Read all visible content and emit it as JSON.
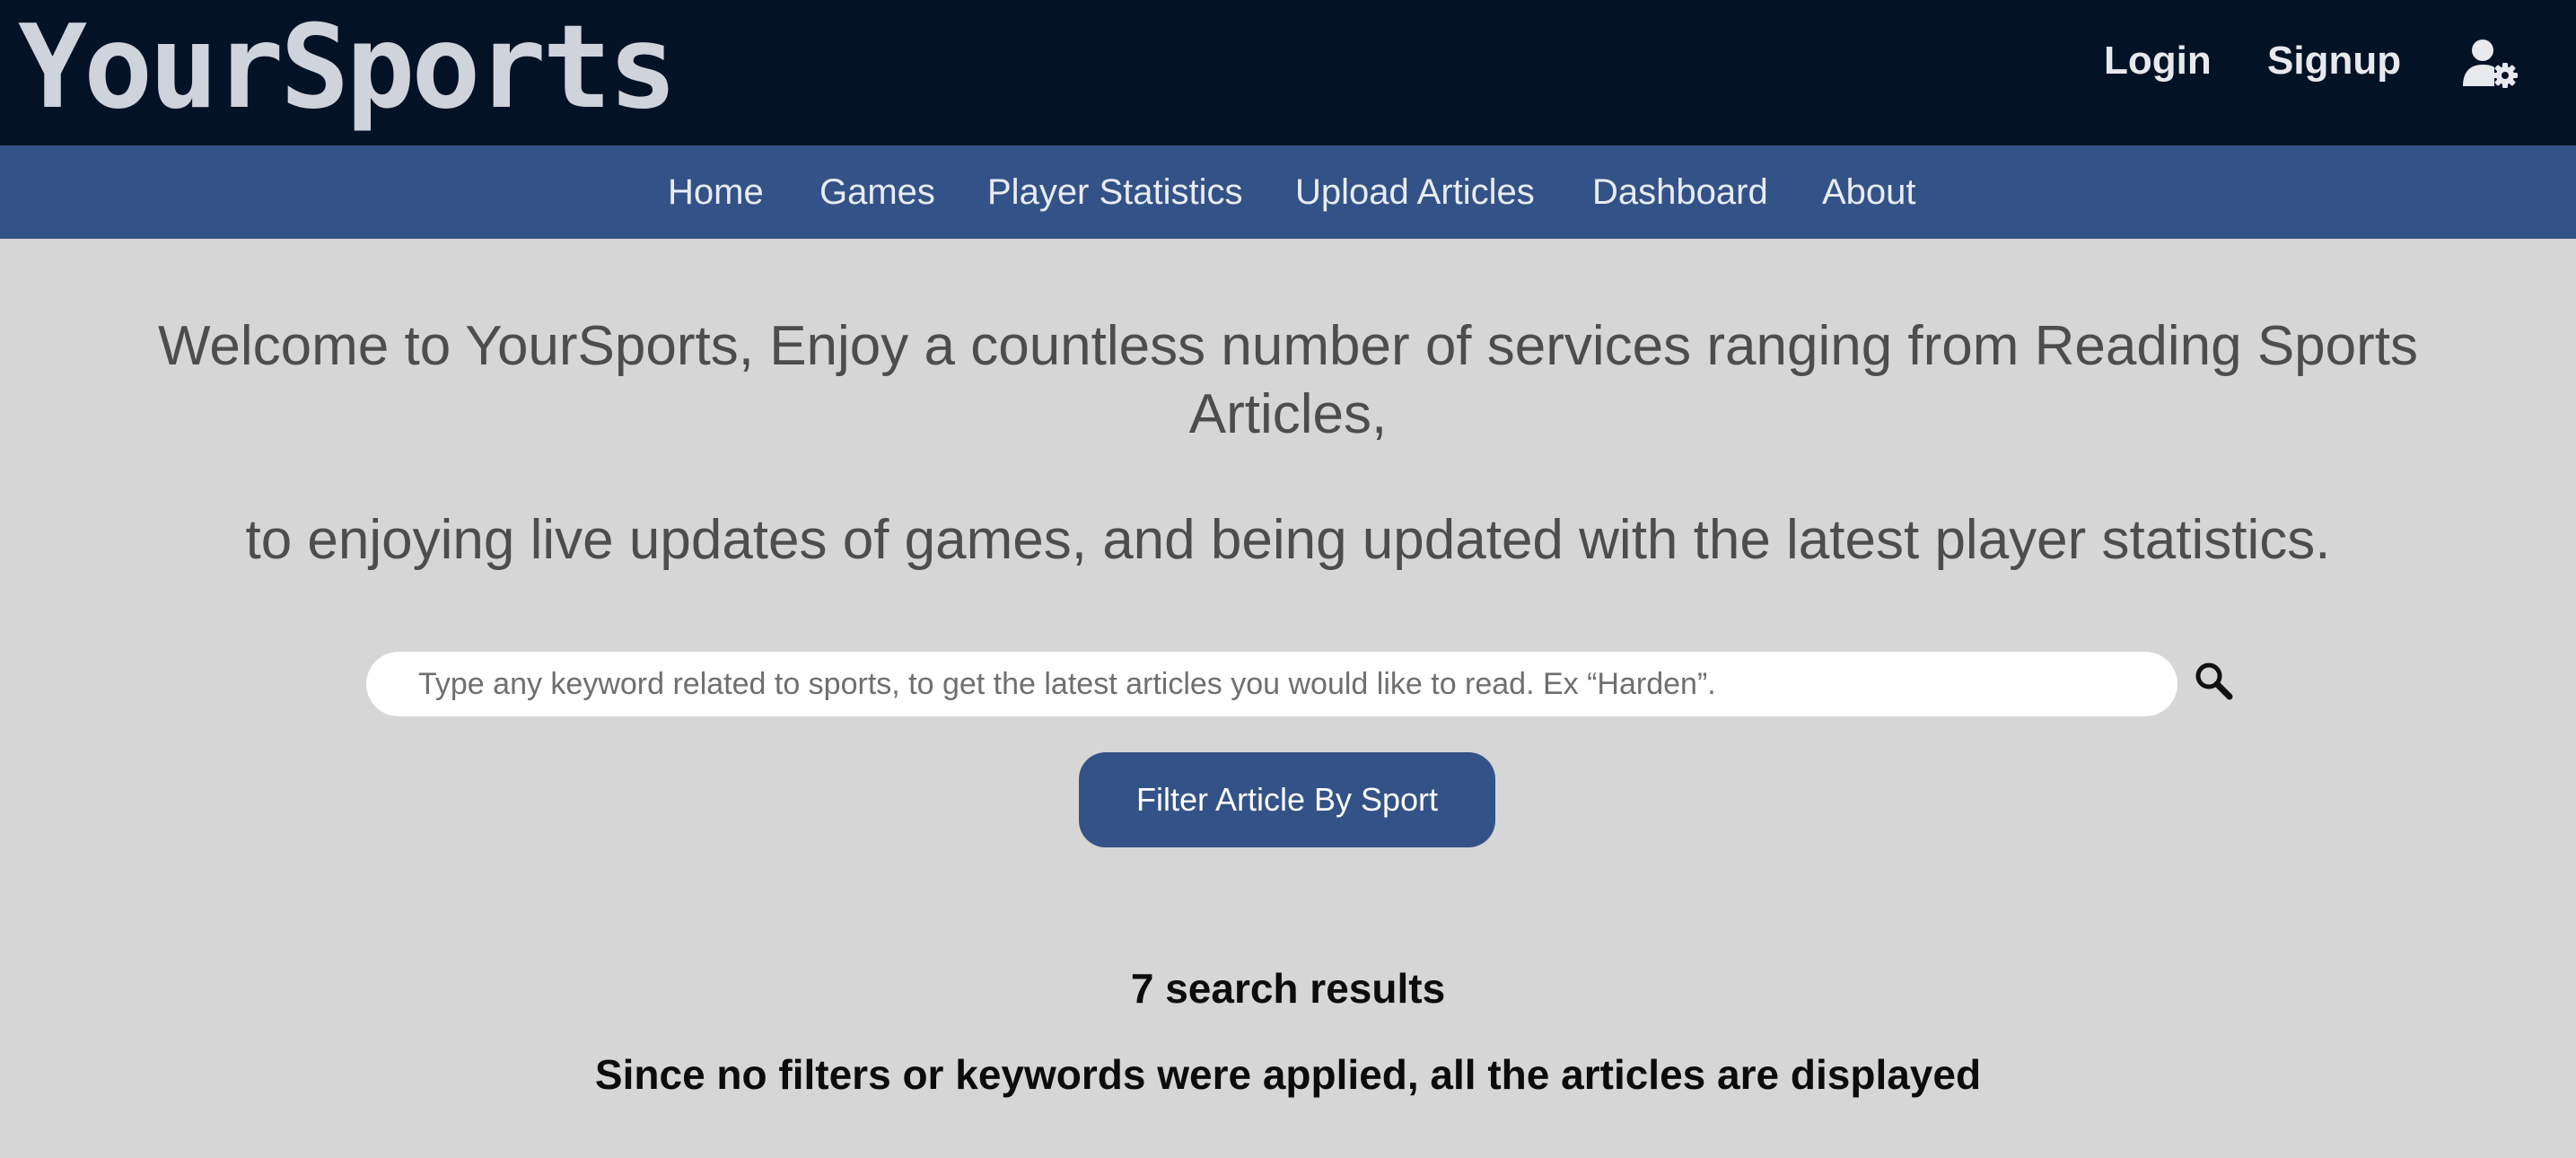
{
  "header": {
    "logo_text": "YourSports",
    "login_label": "Login",
    "signup_label": "Signup",
    "user_settings_icon": "user-gear-icon"
  },
  "nav": {
    "items": [
      {
        "label": "Home"
      },
      {
        "label": "Games"
      },
      {
        "label": "Player Statistics"
      },
      {
        "label": "Upload Articles"
      },
      {
        "label": "Dashboard"
      },
      {
        "label": "About"
      }
    ]
  },
  "main": {
    "welcome_line_1": "Welcome to YourSports, Enjoy a countless number of services ranging from Reading Sports Articles,",
    "welcome_line_2": "to enjoying live updates of games, and being updated with the latest player statistics.",
    "search": {
      "placeholder": "Type any keyword related to sports, to get the latest articles you would like to read. Ex “Harden”.",
      "value": "",
      "icon": "search-icon"
    },
    "filter_button_label": "Filter Article By Sport",
    "results_count": "7 search results",
    "results_note": "Since no filters or keywords were applied, all the articles are displayed"
  },
  "colors": {
    "topbar": "#041226",
    "navbar": "#335287",
    "page_background": "#d6d6d6",
    "button": "#335287",
    "logo": "#cfd3dc"
  }
}
